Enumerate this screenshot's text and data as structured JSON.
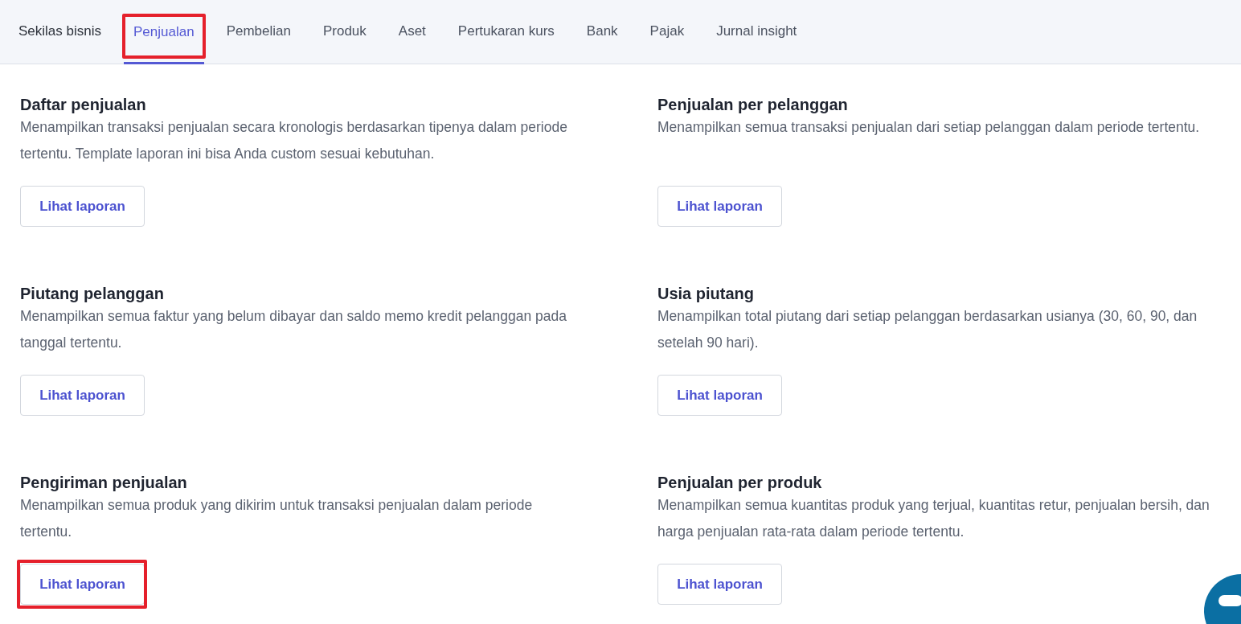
{
  "tabs": [
    {
      "label": "Sekilas bisnis",
      "selected": false,
      "highlighted": false
    },
    {
      "label": "Penjualan",
      "selected": true,
      "highlighted": true
    },
    {
      "label": "Pembelian",
      "selected": false,
      "highlighted": false
    },
    {
      "label": "Produk",
      "selected": false,
      "highlighted": false
    },
    {
      "label": "Aset",
      "selected": false,
      "highlighted": false
    },
    {
      "label": "Pertukaran kurs",
      "selected": false,
      "highlighted": false
    },
    {
      "label": "Bank",
      "selected": false,
      "highlighted": false
    },
    {
      "label": "Pajak",
      "selected": false,
      "highlighted": false
    },
    {
      "label": "Jurnal insight",
      "selected": false,
      "highlighted": false
    }
  ],
  "reports": [
    {
      "title": "Daftar penjualan",
      "description": "Menampilkan transaksi penjualan secara kronologis berdasarkan tipenya dalam periode tertentu. Template laporan ini bisa Anda custom sesuai kebutuhan.",
      "button": "Lihat laporan",
      "button_highlighted": false
    },
    {
      "title": "Penjualan per pelanggan",
      "description": "Menampilkan semua transaksi penjualan dari setiap pelanggan dalam periode tertentu.",
      "button": "Lihat laporan",
      "button_highlighted": false
    },
    {
      "title": "Piutang pelanggan",
      "description": "Menampilkan semua faktur yang belum dibayar dan saldo memo kredit pelanggan pada tanggal tertentu.",
      "button": "Lihat laporan",
      "button_highlighted": false
    },
    {
      "title": "Usia piutang",
      "description": "Menampilkan total piutang dari setiap pelanggan berdasarkan usianya (30, 60, 90, dan setelah 90 hari).",
      "button": "Lihat laporan",
      "button_highlighted": false
    },
    {
      "title": "Pengiriman penjualan",
      "description": "Menampilkan semua produk yang dikirim untuk transaksi penjualan dalam periode tertentu.",
      "button": "Lihat laporan",
      "button_highlighted": true
    },
    {
      "title": "Penjualan per produk",
      "description": "Menampilkan semua kuantitas produk yang terjual, kuantitas retur, penjualan bersih, dan harga penjualan rata-rata dalam periode tertentu.",
      "button": "Lihat laporan",
      "button_highlighted": false
    }
  ]
}
